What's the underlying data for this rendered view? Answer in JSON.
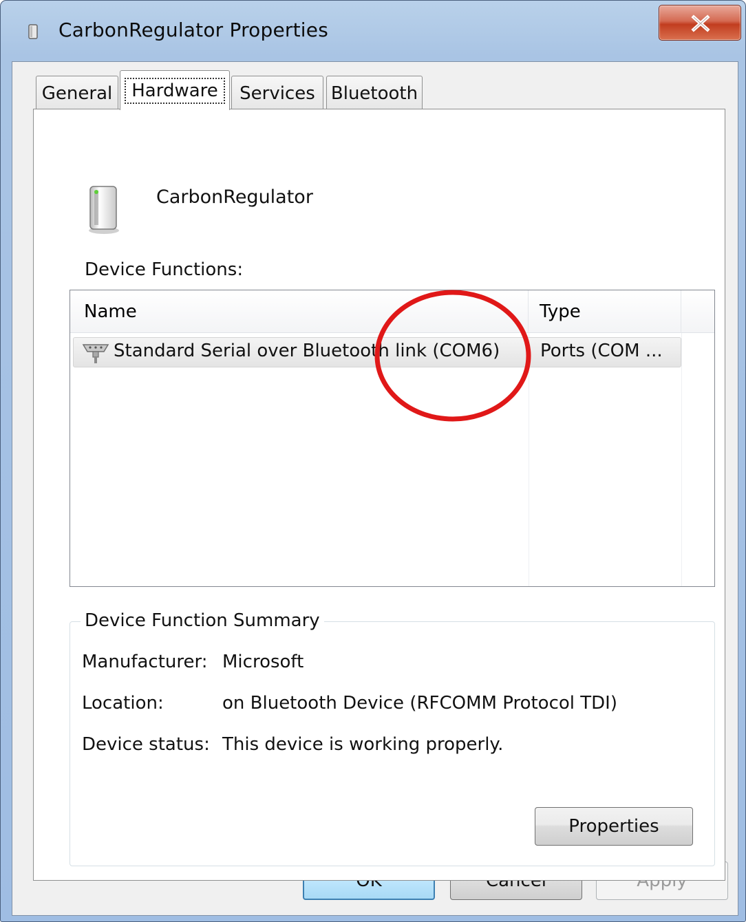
{
  "window": {
    "title": "CarbonRegulator Properties",
    "close_label": "X"
  },
  "tabs": [
    {
      "label": "General",
      "active": false
    },
    {
      "label": "Hardware",
      "active": true
    },
    {
      "label": "Services",
      "active": false
    },
    {
      "label": "Bluetooth",
      "active": false
    }
  ],
  "device": {
    "name": "CarbonRegulator"
  },
  "functions": {
    "label": "Device Functions:",
    "columns": [
      "Name",
      "Type"
    ],
    "rows": [
      {
        "name": "Standard Serial over Bluetooth link (COM6)",
        "type": "Ports (COM ..."
      }
    ]
  },
  "summary": {
    "legend": "Device Function Summary",
    "manufacturer_label": "Manufacturer:",
    "manufacturer_value": "Microsoft",
    "location_label": "Location:",
    "location_value": "on Bluetooth Device (RFCOMM Protocol TDI)",
    "status_label": "Device status:",
    "status_value": "This device is working properly.",
    "properties_label": "Properties"
  },
  "buttons": {
    "ok": "OK",
    "cancel": "Cancel",
    "apply": "Apply"
  },
  "colors": {
    "annotation": "#e01818",
    "titlebar": "#b9d1ea",
    "close": "#c23d1f"
  }
}
